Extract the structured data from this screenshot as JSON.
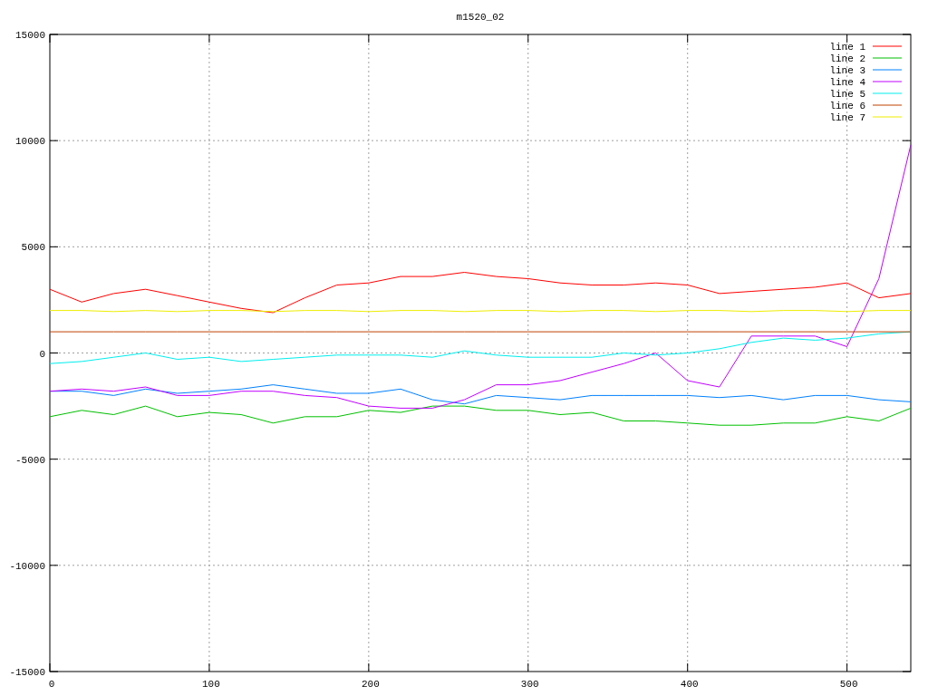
{
  "chart_data": {
    "type": "line",
    "title": "m1520_02",
    "x": [
      0,
      20,
      40,
      60,
      80,
      100,
      120,
      140,
      160,
      180,
      200,
      220,
      240,
      260,
      280,
      300,
      320,
      340,
      360,
      380,
      400,
      420,
      440,
      460,
      480,
      500,
      520,
      540
    ],
    "grid": true,
    "legend": true,
    "xlim": [
      0,
      540
    ],
    "ylim": [
      -15000,
      15000
    ],
    "xticks": [
      0,
      100,
      200,
      300,
      400,
      500
    ],
    "yticks": [
      -15000,
      -10000,
      -5000,
      0,
      5000,
      10000,
      15000
    ],
    "series": [
      {
        "name": "line 1",
        "color": "#ff0000",
        "values": [
          3000,
          2400,
          2800,
          3000,
          2700,
          2400,
          2100,
          1900,
          2600,
          3200,
          3300,
          3600,
          3600,
          3800,
          3600,
          3500,
          3300,
          3200,
          3200,
          3300,
          3200,
          2800,
          2900,
          3000,
          3100,
          3300,
          2600,
          2800
        ]
      },
      {
        "name": "line 2",
        "color": "#00c000",
        "values": [
          -3000,
          -2700,
          -2900,
          -2500,
          -3000,
          -2800,
          -2900,
          -3300,
          -3000,
          -3000,
          -2700,
          -2800,
          -2500,
          -2500,
          -2700,
          -2700,
          -2900,
          -2800,
          -3200,
          -3200,
          -3300,
          -3400,
          -3400,
          -3300,
          -3300,
          -3000,
          -3200,
          -2600
        ]
      },
      {
        "name": "line 3",
        "color": "#0080ff",
        "values": [
          -1800,
          -1800,
          -2000,
          -1700,
          -1900,
          -1800,
          -1700,
          -1500,
          -1700,
          -1900,
          -1900,
          -1700,
          -2200,
          -2400,
          -2000,
          -2100,
          -2200,
          -2000,
          -2000,
          -2000,
          -2000,
          -2100,
          -2000,
          -2200,
          -2000,
          -2000,
          -2200,
          -2300
        ]
      },
      {
        "name": "line 4",
        "color": "#c000ff",
        "values": [
          -1800,
          -1700,
          -1800,
          -1600,
          -2000,
          -2000,
          -1800,
          -1800,
          -2000,
          -2100,
          -2500,
          -2600,
          -2600,
          -2200,
          -1500,
          -1500,
          -1300,
          -900,
          -500,
          0,
          -1300,
          -1600,
          800,
          800,
          800,
          300,
          3500,
          9800
        ]
      },
      {
        "name": "line 5",
        "color": "#00eeee",
        "values": [
          -500,
          -400,
          -200,
          0,
          -300,
          -200,
          -400,
          -300,
          -200,
          -100,
          -100,
          -100,
          -200,
          100,
          -100,
          -200,
          -200,
          -200,
          0,
          -100,
          0,
          200,
          500,
          700,
          600,
          700,
          900,
          1000
        ]
      },
      {
        "name": "line 6",
        "color": "#c04000",
        "values": [
          1000,
          1000,
          1000,
          1000,
          1000,
          1000,
          1000,
          1000,
          1000,
          1000,
          1000,
          1000,
          1000,
          1000,
          1000,
          1000,
          1000,
          1000,
          1000,
          1000,
          1000,
          1000,
          1000,
          1000,
          1000,
          1000,
          1000,
          1000
        ]
      },
      {
        "name": "line 7",
        "color": "#eeee00",
        "values": [
          2000,
          2000,
          1950,
          2000,
          1950,
          2000,
          2000,
          1950,
          2000,
          2000,
          1950,
          2000,
          2000,
          1950,
          2000,
          2000,
          1950,
          2000,
          2000,
          1950,
          2000,
          2000,
          1950,
          2000,
          2000,
          1950,
          2000,
          2000
        ]
      }
    ]
  }
}
